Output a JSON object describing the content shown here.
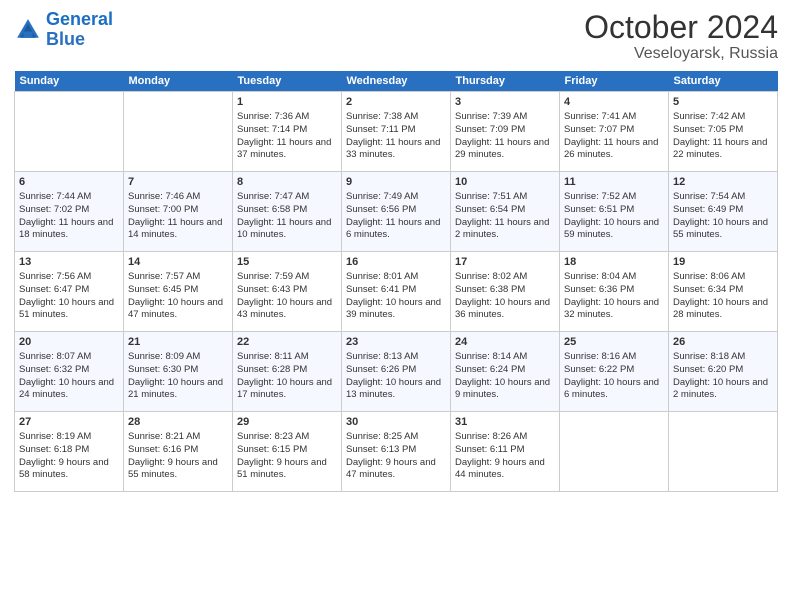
{
  "header": {
    "logo_line1": "General",
    "logo_line2": "Blue",
    "month": "October 2024",
    "location": "Veseloyarsk, Russia"
  },
  "days_of_week": [
    "Sunday",
    "Monday",
    "Tuesday",
    "Wednesday",
    "Thursday",
    "Friday",
    "Saturday"
  ],
  "weeks": [
    [
      {
        "day": "",
        "info": ""
      },
      {
        "day": "",
        "info": ""
      },
      {
        "day": "1",
        "info": "Sunrise: 7:36 AM\nSunset: 7:14 PM\nDaylight: 11 hours and 37 minutes."
      },
      {
        "day": "2",
        "info": "Sunrise: 7:38 AM\nSunset: 7:11 PM\nDaylight: 11 hours and 33 minutes."
      },
      {
        "day": "3",
        "info": "Sunrise: 7:39 AM\nSunset: 7:09 PM\nDaylight: 11 hours and 29 minutes."
      },
      {
        "day": "4",
        "info": "Sunrise: 7:41 AM\nSunset: 7:07 PM\nDaylight: 11 hours and 26 minutes."
      },
      {
        "day": "5",
        "info": "Sunrise: 7:42 AM\nSunset: 7:05 PM\nDaylight: 11 hours and 22 minutes."
      }
    ],
    [
      {
        "day": "6",
        "info": "Sunrise: 7:44 AM\nSunset: 7:02 PM\nDaylight: 11 hours and 18 minutes."
      },
      {
        "day": "7",
        "info": "Sunrise: 7:46 AM\nSunset: 7:00 PM\nDaylight: 11 hours and 14 minutes."
      },
      {
        "day": "8",
        "info": "Sunrise: 7:47 AM\nSunset: 6:58 PM\nDaylight: 11 hours and 10 minutes."
      },
      {
        "day": "9",
        "info": "Sunrise: 7:49 AM\nSunset: 6:56 PM\nDaylight: 11 hours and 6 minutes."
      },
      {
        "day": "10",
        "info": "Sunrise: 7:51 AM\nSunset: 6:54 PM\nDaylight: 11 hours and 2 minutes."
      },
      {
        "day": "11",
        "info": "Sunrise: 7:52 AM\nSunset: 6:51 PM\nDaylight: 10 hours and 59 minutes."
      },
      {
        "day": "12",
        "info": "Sunrise: 7:54 AM\nSunset: 6:49 PM\nDaylight: 10 hours and 55 minutes."
      }
    ],
    [
      {
        "day": "13",
        "info": "Sunrise: 7:56 AM\nSunset: 6:47 PM\nDaylight: 10 hours and 51 minutes."
      },
      {
        "day": "14",
        "info": "Sunrise: 7:57 AM\nSunset: 6:45 PM\nDaylight: 10 hours and 47 minutes."
      },
      {
        "day": "15",
        "info": "Sunrise: 7:59 AM\nSunset: 6:43 PM\nDaylight: 10 hours and 43 minutes."
      },
      {
        "day": "16",
        "info": "Sunrise: 8:01 AM\nSunset: 6:41 PM\nDaylight: 10 hours and 39 minutes."
      },
      {
        "day": "17",
        "info": "Sunrise: 8:02 AM\nSunset: 6:38 PM\nDaylight: 10 hours and 36 minutes."
      },
      {
        "day": "18",
        "info": "Sunrise: 8:04 AM\nSunset: 6:36 PM\nDaylight: 10 hours and 32 minutes."
      },
      {
        "day": "19",
        "info": "Sunrise: 8:06 AM\nSunset: 6:34 PM\nDaylight: 10 hours and 28 minutes."
      }
    ],
    [
      {
        "day": "20",
        "info": "Sunrise: 8:07 AM\nSunset: 6:32 PM\nDaylight: 10 hours and 24 minutes."
      },
      {
        "day": "21",
        "info": "Sunrise: 8:09 AM\nSunset: 6:30 PM\nDaylight: 10 hours and 21 minutes."
      },
      {
        "day": "22",
        "info": "Sunrise: 8:11 AM\nSunset: 6:28 PM\nDaylight: 10 hours and 17 minutes."
      },
      {
        "day": "23",
        "info": "Sunrise: 8:13 AM\nSunset: 6:26 PM\nDaylight: 10 hours and 13 minutes."
      },
      {
        "day": "24",
        "info": "Sunrise: 8:14 AM\nSunset: 6:24 PM\nDaylight: 10 hours and 9 minutes."
      },
      {
        "day": "25",
        "info": "Sunrise: 8:16 AM\nSunset: 6:22 PM\nDaylight: 10 hours and 6 minutes."
      },
      {
        "day": "26",
        "info": "Sunrise: 8:18 AM\nSunset: 6:20 PM\nDaylight: 10 hours and 2 minutes."
      }
    ],
    [
      {
        "day": "27",
        "info": "Sunrise: 8:19 AM\nSunset: 6:18 PM\nDaylight: 9 hours and 58 minutes."
      },
      {
        "day": "28",
        "info": "Sunrise: 8:21 AM\nSunset: 6:16 PM\nDaylight: 9 hours and 55 minutes."
      },
      {
        "day": "29",
        "info": "Sunrise: 8:23 AM\nSunset: 6:15 PM\nDaylight: 9 hours and 51 minutes."
      },
      {
        "day": "30",
        "info": "Sunrise: 8:25 AM\nSunset: 6:13 PM\nDaylight: 9 hours and 47 minutes."
      },
      {
        "day": "31",
        "info": "Sunrise: 8:26 AM\nSunset: 6:11 PM\nDaylight: 9 hours and 44 minutes."
      },
      {
        "day": "",
        "info": ""
      },
      {
        "day": "",
        "info": ""
      }
    ]
  ]
}
